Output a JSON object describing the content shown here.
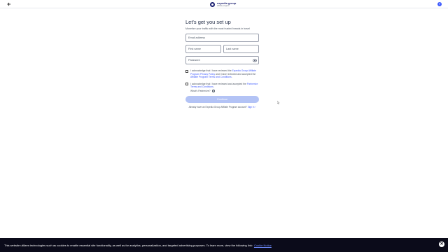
{
  "header": {
    "brand_name": "expedia group",
    "brand_sub": "affiliate program",
    "back_icon": "arrow-left-icon",
    "help_icon": "help-circle-icon",
    "help_glyph": "?"
  },
  "form": {
    "title": "Let's get you set up",
    "subtitle": "Monetize your traffic with the most trusted brands in travel",
    "email_placeholder": "Email address",
    "first_name_placeholder": "First name",
    "last_name_placeholder": "Last name",
    "password_placeholder": "Password",
    "consent1_prefix": "I acknowledge that I have reviewed the ",
    "consent1_link": "Expedia Group Affiliate Program Privacy Policy",
    "consent1_middle": " and I have reviewed and accepted the ",
    "consent1_link2": "Affiliate Program Terms and Conditions",
    "consent1_suffix": ".",
    "consent2_prefix": "I acknowledge that I have reviewed and accepted the ",
    "consent2_link": "Partnerize Terms and Conditions",
    "consent2_suffix": ".",
    "whats_partnerize": "What's Partnerize?",
    "continue_label": "Continue",
    "signin_prefix": "Already have an Expedia Group Affiliate Program account? ",
    "signin_link": "Sign in"
  },
  "cookie": {
    "text": "This website utilizes technologies such as cookies to enable essential site functionality, as well as for analytics, personalization, and targeted advertising purposes. To learn more, view the following link:",
    "link": "Cookie Notice",
    "close_glyph": "✕"
  },
  "colors": {
    "brand": "#1a1f71",
    "link": "#3d5afe",
    "button_disabled": "#b3c3f5",
    "cookie_bg": "#0b0b1a"
  }
}
